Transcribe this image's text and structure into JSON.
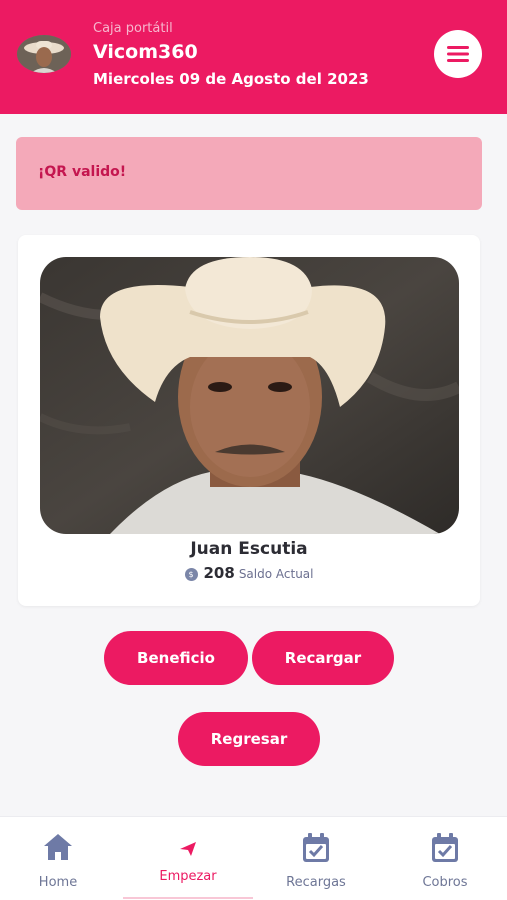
{
  "header": {
    "subtitle": "Caja portátil",
    "title": "Vicom360",
    "date": "Miercoles 09 de Agosto del 2023",
    "color": "#ec1a62"
  },
  "alert": {
    "message": "¡QR valido!"
  },
  "profile": {
    "name": "Juan Escutia",
    "balance_amount": "208",
    "balance_label": "Saldo Actual"
  },
  "actions": {
    "beneficio": "Beneficio",
    "recargar": "Recargar",
    "regresar": "Regresar"
  },
  "nav": {
    "items": [
      {
        "label": "Home",
        "icon": "home-icon"
      },
      {
        "label": "Empezar",
        "icon": "send-icon",
        "active": true
      },
      {
        "label": "Recargas",
        "icon": "calendar-check-icon"
      },
      {
        "label": "Cobros",
        "icon": "calendar-check-icon"
      }
    ]
  }
}
